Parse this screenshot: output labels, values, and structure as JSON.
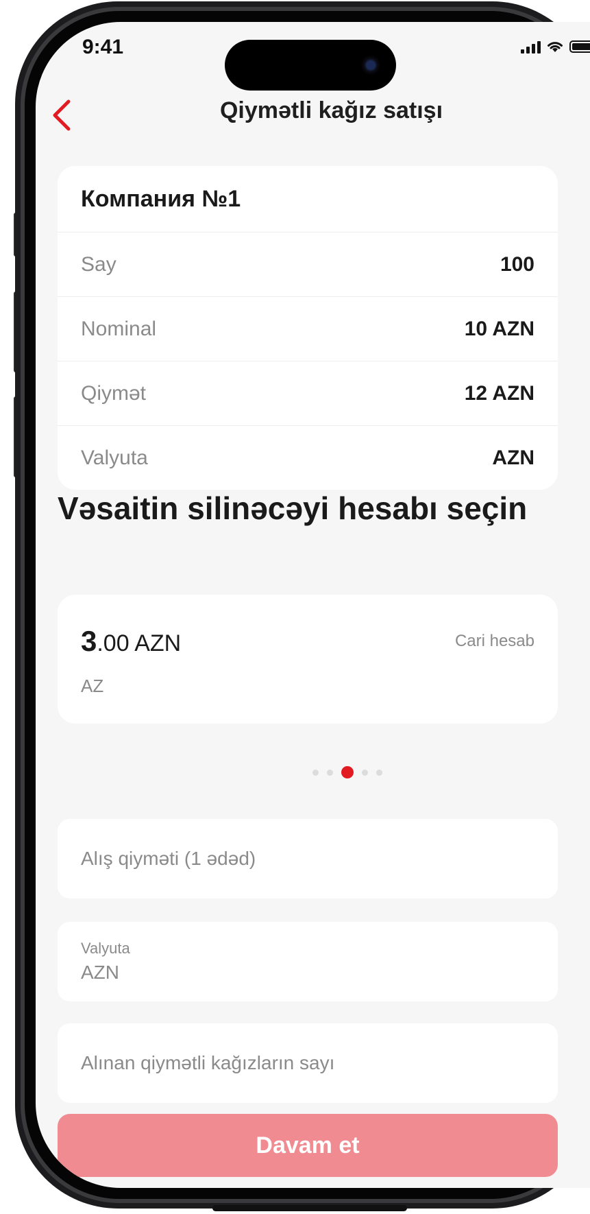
{
  "status_bar": {
    "time": "9:41"
  },
  "header": {
    "title": "Qiymətli kağız satışı"
  },
  "security": {
    "company": "Компания №1",
    "rows": [
      {
        "label": "Say",
        "value": "100"
      },
      {
        "label": "Nominal",
        "value": "10 AZN"
      },
      {
        "label": "Qiymət",
        "value": "12 AZN"
      },
      {
        "label": "Valyuta",
        "value": "AZN"
      }
    ]
  },
  "section_title": "Vəsaitin silinəcəyi hesabı seçin",
  "account": {
    "amount_int": "3",
    "amount_rest": ".00 AZN",
    "type": "Cari hesab",
    "number": "AZ"
  },
  "carousel": {
    "count": 5,
    "active_index": 2
  },
  "form": {
    "price_placeholder": "Alış qiyməti (1 ədəd)",
    "currency_label": "Valyuta",
    "currency_value": "AZN",
    "quantity_placeholder": "Alınan qiymətli kağızların sayı"
  },
  "cta": {
    "label": "Davam et"
  },
  "colors": {
    "accent": "#e21b23",
    "cta_disabled": "#f08c91",
    "background": "#f6f6f6"
  }
}
